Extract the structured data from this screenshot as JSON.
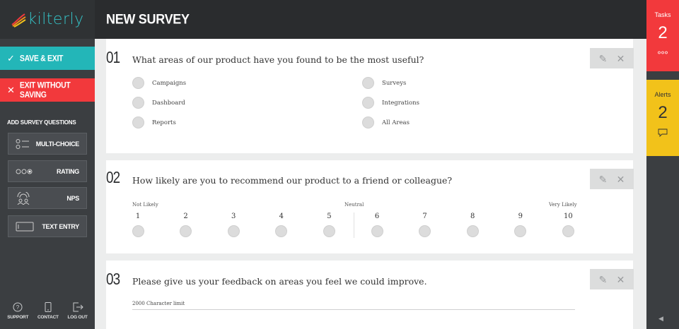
{
  "app": {
    "logo_text": "kilterly"
  },
  "header": {
    "title": "NEW SURVEY"
  },
  "sidebar": {
    "save_label": "SAVE & EXIT",
    "exit_label": "EXIT WITHOUT SAVING",
    "add_title": "ADD SURVEY QUESTIONS",
    "question_types": [
      {
        "label": "MULTI-CHOICE",
        "icon": "multi-choice-icon"
      },
      {
        "label": "RATING",
        "icon": "rating-icon"
      },
      {
        "label": "NPS",
        "icon": "nps-icon"
      },
      {
        "label": "TEXT ENTRY",
        "icon": "text-entry-icon"
      }
    ],
    "footer": [
      {
        "label": "SUPPORT",
        "icon": "help-icon"
      },
      {
        "label": "CONTACT",
        "icon": "phone-icon"
      },
      {
        "label": "LOG OUT",
        "icon": "logout-icon"
      }
    ]
  },
  "questions": [
    {
      "number": "01",
      "text": "What areas of our product have you found to be the most useful?",
      "options": [
        "Campaigns",
        "Dashboard",
        "Reports",
        "Surveys",
        "Integrations",
        "All Areas"
      ]
    },
    {
      "number": "02",
      "text": "How likely are you to recommend our product to a friend or colleague?",
      "low_label": "Not Likely",
      "mid_label": "Neutral",
      "high_label": "Very Likely",
      "scale": [
        "1",
        "2",
        "3",
        "4",
        "5",
        "6",
        "7",
        "8",
        "9",
        "10"
      ]
    },
    {
      "number": "03",
      "text": "Please give us your feedback on areas you feel we could improve.",
      "char_limit": "2000 Character limit"
    }
  ],
  "right_panel": {
    "tasks_label": "Tasks",
    "tasks_count": "2",
    "alerts_label": "Alerts",
    "alerts_count": "2"
  },
  "colors": {
    "teal": "#23b6b8",
    "red": "#f2393c",
    "yellow": "#f2c21a",
    "sidebar": "#3b3e41",
    "header": "#2a2c2e"
  }
}
